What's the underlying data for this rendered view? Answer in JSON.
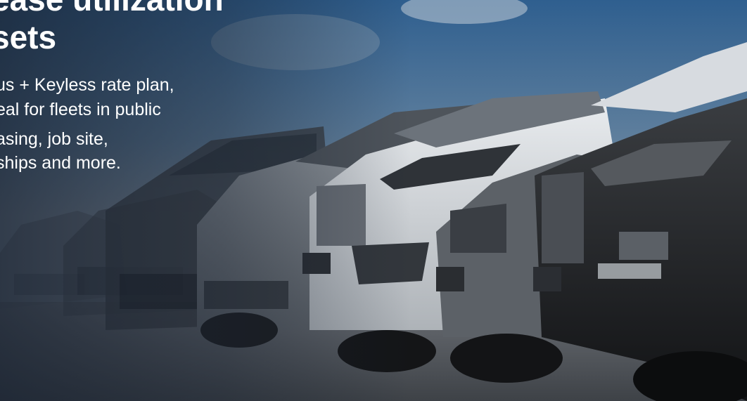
{
  "hero": {
    "headline_lines": [
      "ease utilization",
      "sets"
    ],
    "body_lines": [
      "us + Keyless rate plan,",
      "eal for fleets in public",
      "asing, job site,",
      "ships and more."
    ]
  },
  "colors": {
    "sky_top": "#2f5f8f",
    "sky_mid": "#6f8fac",
    "ground": "#4b4f55",
    "text": "#ffffff"
  }
}
